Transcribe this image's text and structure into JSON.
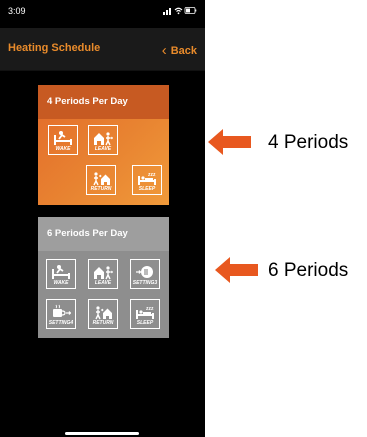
{
  "status_bar": {
    "time": "3:09",
    "indicators": "..ıl ◠ ▭"
  },
  "nav": {
    "title": "Heating Schedule",
    "back_label": "Back"
  },
  "cards": [
    {
      "title": "4 Periods Per Day",
      "tiles": [
        {
          "label": "WAKE",
          "icon": "bed-wake-icon"
        },
        {
          "label": "LEAVE",
          "icon": "leave-home-icon"
        },
        {
          "label": "RETURN",
          "icon": "return-home-icon"
        },
        {
          "label": "SLEEP",
          "icon": "bed-sleep-icon"
        }
      ]
    },
    {
      "title": "6 Periods Per Day",
      "tiles": [
        {
          "label": "WAKE",
          "icon": "bed-wake-icon"
        },
        {
          "label": "LEAVE",
          "icon": "leave-home-icon"
        },
        {
          "label": "SETTING3",
          "icon": "setting3-icon"
        },
        {
          "label": "SETTING4",
          "icon": "setting4-icon"
        },
        {
          "label": "RETURN",
          "icon": "return-home-icon"
        },
        {
          "label": "SLEEP",
          "icon": "bed-sleep-icon"
        }
      ]
    }
  ],
  "annotations": [
    {
      "text": "4 Periods",
      "arrow_color": "#e8581f"
    },
    {
      "text": "6 Periods",
      "arrow_color": "#e8581f"
    }
  ],
  "colors": {
    "accent": "#e98b2b",
    "orange_card": "#e5752d",
    "gray_card": "#8e8e8e",
    "arrow": "#e8581f"
  }
}
